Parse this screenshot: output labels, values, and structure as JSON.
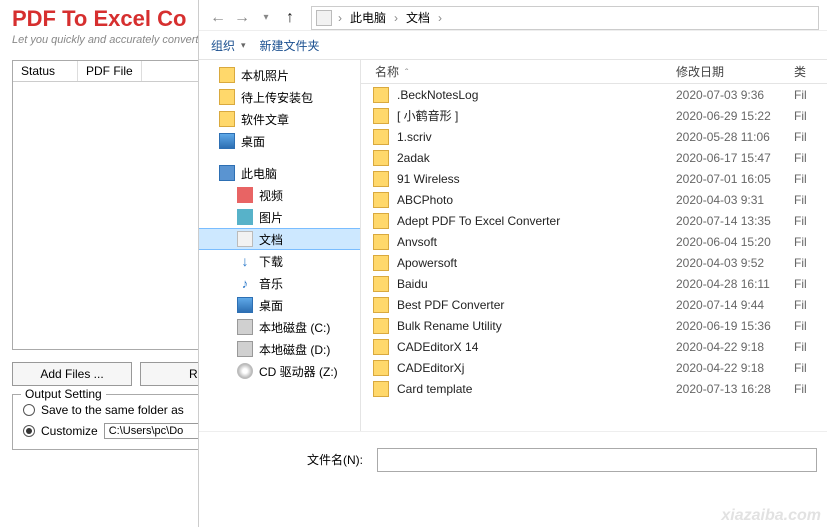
{
  "app": {
    "title": "PDF To Excel Co",
    "subtitle": "Let you quickly and accurately convert",
    "table": {
      "status_header": "Status",
      "file_header": "PDF File"
    },
    "buttons": {
      "add_files": "Add Files ...",
      "remove": "Ren"
    },
    "output": {
      "legend": "Output Setting",
      "save_same": "Save to the same folder as",
      "customize": "Customize",
      "customize_path": "C:\\Users\\pc\\Do"
    }
  },
  "dialog": {
    "breadcrumb": {
      "item1": "此电脑",
      "item2": "文档"
    },
    "toolbar": {
      "organize": "组织",
      "new_folder": "新建文件夹"
    },
    "tree": [
      {
        "icon": "folder",
        "label": "本机照片",
        "indent": 1
      },
      {
        "icon": "folder",
        "label": "待上传安装包",
        "indent": 1
      },
      {
        "icon": "folder",
        "label": "软件文章",
        "indent": 1
      },
      {
        "icon": "desktop",
        "label": "桌面",
        "indent": 1
      },
      {
        "spacer": true
      },
      {
        "icon": "pc",
        "label": "此电脑",
        "indent": 1
      },
      {
        "icon": "video",
        "label": "视频",
        "indent": 2
      },
      {
        "icon": "images",
        "label": "图片",
        "indent": 2
      },
      {
        "icon": "docs",
        "label": "文档",
        "indent": 2,
        "selected": true
      },
      {
        "icon": "download",
        "label": "下载",
        "indent": 2
      },
      {
        "icon": "music",
        "label": "音乐",
        "indent": 2
      },
      {
        "icon": "desktop",
        "label": "桌面",
        "indent": 2
      },
      {
        "icon": "disk",
        "label": "本地磁盘 (C:)",
        "indent": 2
      },
      {
        "icon": "disk",
        "label": "本地磁盘 (D:)",
        "indent": 2
      },
      {
        "icon": "cd",
        "label": "CD 驱动器 (Z:)",
        "indent": 2
      }
    ],
    "columns": {
      "name": "名称",
      "date": "修改日期",
      "type": "类"
    },
    "files": [
      {
        "name": ".BeckNotesLog",
        "date": "2020-07-03 9:36",
        "type": "Fil"
      },
      {
        "name": "[ 小鹤音形 ]",
        "date": "2020-06-29 15:22",
        "type": "Fil"
      },
      {
        "name": "1.scriv",
        "date": "2020-05-28 11:06",
        "type": "Fil"
      },
      {
        "name": "2adak",
        "date": "2020-06-17 15:47",
        "type": "Fil"
      },
      {
        "name": "91 Wireless",
        "date": "2020-07-01 16:05",
        "type": "Fil"
      },
      {
        "name": "ABCPhoto",
        "date": "2020-04-03 9:31",
        "type": "Fil"
      },
      {
        "name": "Adept PDF To Excel Converter",
        "date": "2020-07-14 13:35",
        "type": "Fil"
      },
      {
        "name": "Anvsoft",
        "date": "2020-06-04 15:20",
        "type": "Fil"
      },
      {
        "name": "Apowersoft",
        "date": "2020-04-03 9:52",
        "type": "Fil"
      },
      {
        "name": "Baidu",
        "date": "2020-04-28 16:11",
        "type": "Fil"
      },
      {
        "name": "Best PDF Converter",
        "date": "2020-07-14 9:44",
        "type": "Fil"
      },
      {
        "name": "Bulk Rename Utility",
        "date": "2020-06-19 15:36",
        "type": "Fil"
      },
      {
        "name": "CADEditorX 14",
        "date": "2020-04-22 9:18",
        "type": "Fil"
      },
      {
        "name": "CADEditorXj",
        "date": "2020-04-22 9:18",
        "type": "Fil"
      },
      {
        "name": "Card template",
        "date": "2020-07-13 16:28",
        "type": "Fil"
      }
    ],
    "filename_label": "文件名(N):",
    "filename_value": ""
  },
  "watermark": "xiazaiba.com"
}
